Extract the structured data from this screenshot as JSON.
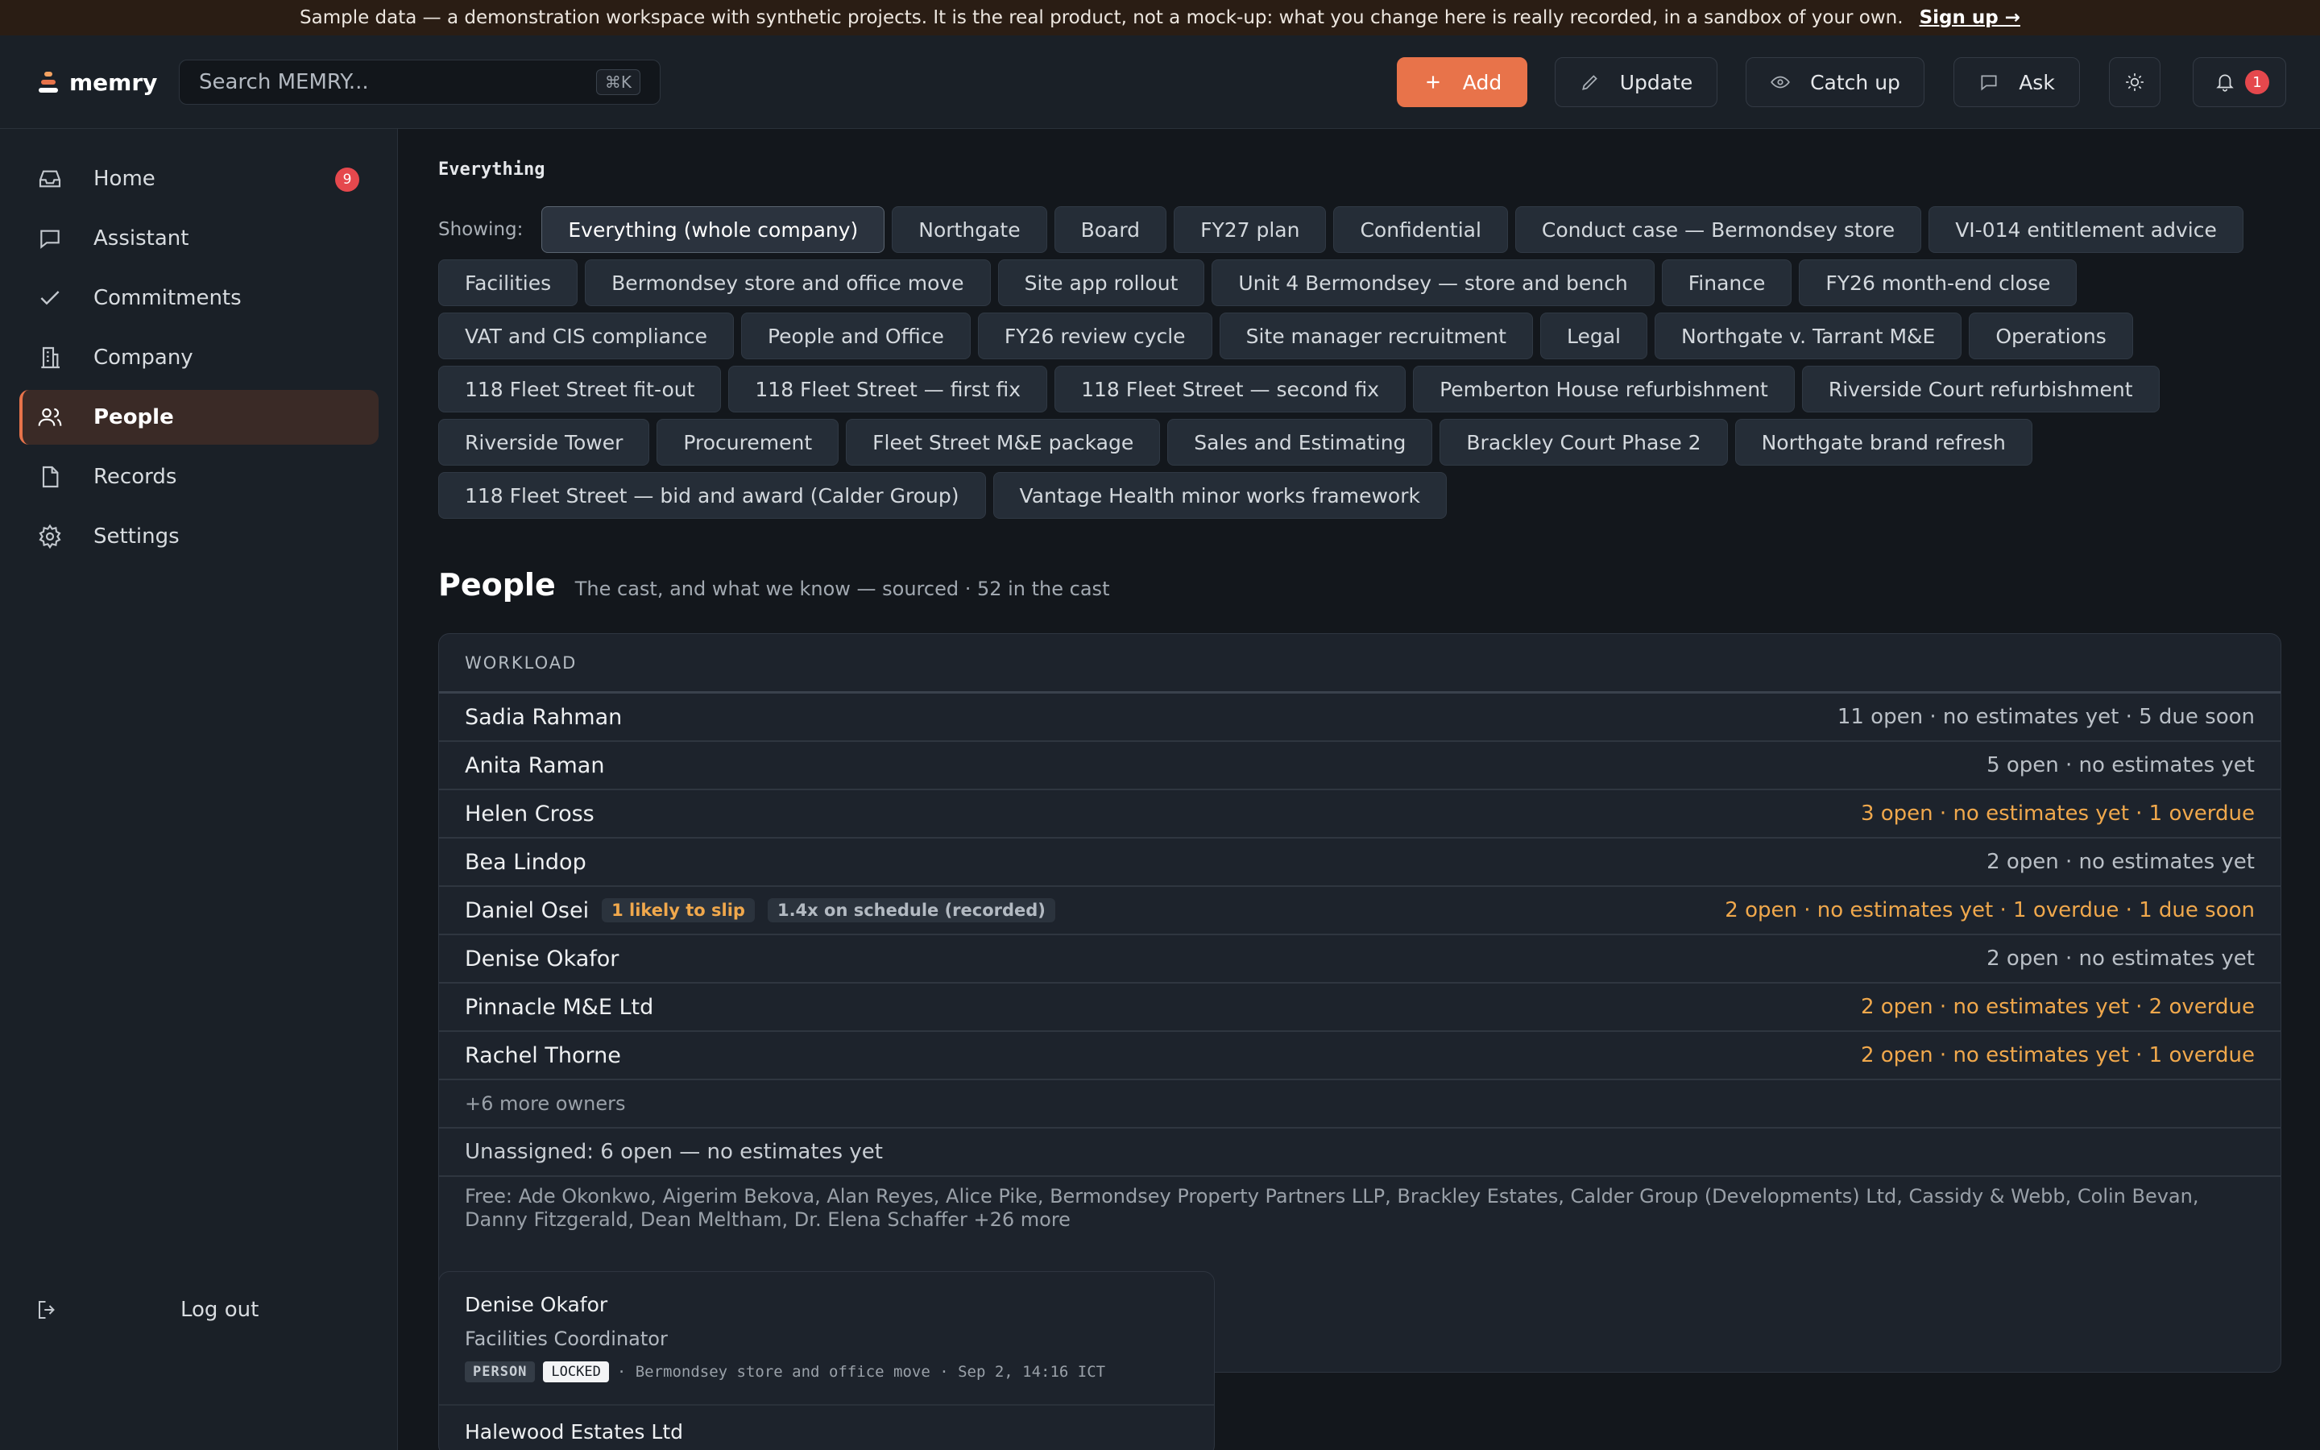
{
  "banner": {
    "text": "Sample data — a demonstration workspace with synthetic projects. It is the real product, not a mock-up: what you change here is really recorded, in a sandbox of your own.",
    "signup_label": "Sign up →"
  },
  "header": {
    "brand": "memry",
    "search_placeholder": "Search MEMRY...",
    "search_shortcut": "⌘K",
    "buttons": {
      "add": "Add",
      "update": "Update",
      "catch_up": "Catch up",
      "ask": "Ask"
    },
    "notification_count": "1"
  },
  "sidebar": {
    "items": [
      {
        "label": "Home",
        "icon": "inbox-icon",
        "badge": "9"
      },
      {
        "label": "Assistant",
        "icon": "chat-icon"
      },
      {
        "label": "Commitments",
        "icon": "check-icon"
      },
      {
        "label": "Company",
        "icon": "building-icon"
      },
      {
        "label": "People",
        "icon": "users-icon",
        "active": true
      },
      {
        "label": "Records",
        "icon": "file-icon"
      },
      {
        "label": "Settings",
        "icon": "gear-icon"
      }
    ],
    "logout_label": "Log out"
  },
  "scope": {
    "title": "Everything",
    "showing_label": "Showing:",
    "chips": [
      "Everything (whole company)",
      "Northgate",
      "Board",
      "FY27 plan",
      "Confidential",
      "Conduct case — Bermondsey store",
      "VI-014 entitlement advice",
      "Facilities",
      "Bermondsey store and office move",
      "Site app rollout",
      "Unit 4 Bermondsey — store and bench",
      "Finance",
      "FY26 month-end close",
      "VAT and CIS compliance",
      "People and Office",
      "FY26 review cycle",
      "Site manager recruitment",
      "Legal",
      "Northgate v. Tarrant M&E",
      "Operations",
      "118 Fleet Street fit-out",
      "118 Fleet Street — first fix",
      "118 Fleet Street — second fix",
      "Pemberton House refurbishment",
      "Riverside Court refurbishment",
      "Riverside Tower",
      "Procurement",
      "Fleet Street M&E package",
      "Sales and Estimating",
      "Brackley Court Phase 2",
      "Northgate brand refresh",
      "118 Fleet Street — bid and award (Calder Group)",
      "Vantage Health minor works framework"
    ]
  },
  "people": {
    "title": "People",
    "subtitle": "The cast, and what we know — sourced · 52 in the cast",
    "workload": {
      "header": "WORKLOAD",
      "rows": [
        {
          "name": "Sadia Rahman",
          "stat": "11 open · no estimates yet · 5 due soon",
          "warn": false
        },
        {
          "name": "Anita Raman",
          "stat": "5 open · no estimates yet",
          "warn": false
        },
        {
          "name": "Helen Cross",
          "stat": "3 open · no estimates yet · 1 overdue",
          "warn": true
        },
        {
          "name": "Bea Lindop",
          "stat": "2 open · no estimates yet",
          "warn": false
        },
        {
          "name": "Daniel Osei",
          "stat": "2 open · no estimates yet · 1 overdue · 1 due soon",
          "warn": true,
          "tags": [
            "1 likely to slip",
            "1.4x on schedule (recorded)"
          ]
        },
        {
          "name": "Denise Okafor",
          "stat": "2 open · no estimates yet",
          "warn": false
        },
        {
          "name": "Pinnacle M&E Ltd",
          "stat": "2 open · no estimates yet · 2 overdue",
          "warn": true
        },
        {
          "name": "Rachel Thorne",
          "stat": "2 open · no estimates yet · 1 overdue",
          "warn": true
        }
      ],
      "more": "+6 more owners",
      "unassigned": "Unassigned: 6 open — no estimates yet",
      "free": "Free: Ade Okonkwo, Aigerim Bekova, Alan Reyes, Alice Pike, Bermondsey Property Partners LLP, Brackley Estates, Calder Group (Developments) Ltd, Cassidy & Webb, Colin Bevan, Danny Fitzgerald, Dean Meltham, Dr. Elena Schaffer +26 more"
    },
    "card": {
      "name": "Denise Okafor",
      "role": "Facilities Coordinator",
      "type_pill": "PERSON",
      "locked_pill": "LOCKED",
      "meta": "· Bermondsey store and office move · Sep 2, 14:16 ICT",
      "next_name": "Halewood Estates Ltd"
    }
  },
  "colors": {
    "accent": "#e8734a",
    "warning": "#f0a84c",
    "badge": "#e5484d"
  }
}
